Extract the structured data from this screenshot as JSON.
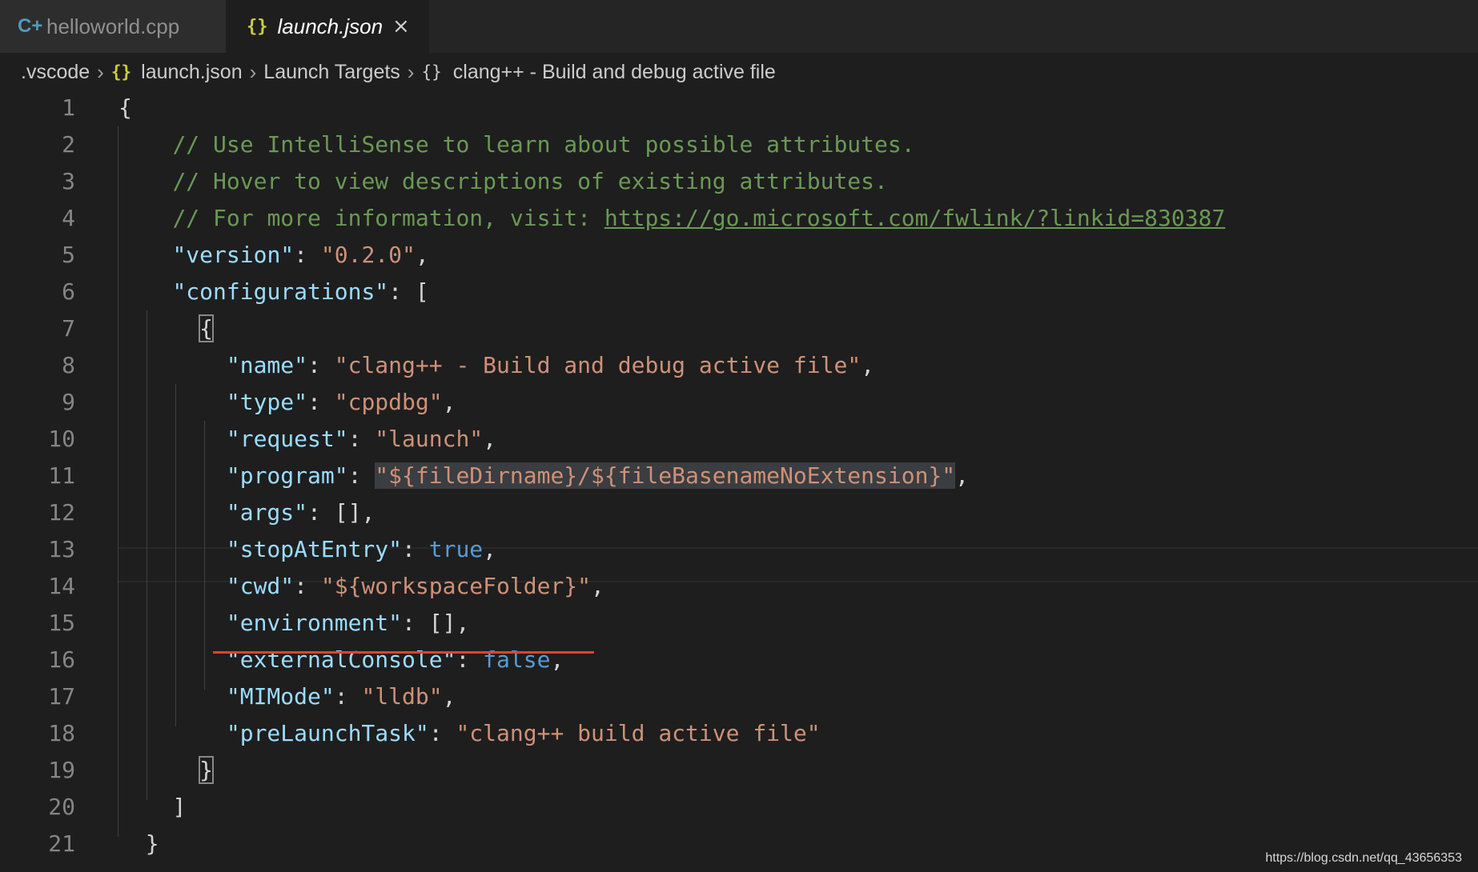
{
  "tabs": [
    {
      "label": "helloworld.cpp",
      "icon": "cpp-file-icon",
      "active": false
    },
    {
      "label": "launch.json",
      "icon": "json-file-icon",
      "active": true,
      "close_glyph": "×"
    }
  ],
  "breadcrumb": {
    "items": [
      ".vscode",
      "launch.json",
      "Launch Targets",
      "clang++ - Build and debug active file"
    ],
    "separator": "›",
    "json_icon": "{}",
    "object_icon": "{}"
  },
  "editor": {
    "line_numbers": [
      "1",
      "2",
      "3",
      "4",
      "5",
      "6",
      "7",
      "8",
      "9",
      "10",
      "11",
      "12",
      "13",
      "14",
      "15",
      "16",
      "17",
      "18",
      "19",
      "20",
      "21"
    ],
    "comments": {
      "line2": "// Use IntelliSense to learn about possible attributes.",
      "line3": "// Hover to view descriptions of existing attributes.",
      "line4_prefix": "// For more information, visit: ",
      "line4_link": "https://go.microsoft.com/fwlink/?linkid=830387"
    },
    "keys": {
      "version": "\"version\"",
      "configurations": "\"configurations\"",
      "name": "\"name\"",
      "type": "\"type\"",
      "request": "\"request\"",
      "program": "\"program\"",
      "args": "\"args\"",
      "stopAtEntry": "\"stopAtEntry\"",
      "cwd": "\"cwd\"",
      "environment": "\"environment\"",
      "externalConsole": "\"externalConsole\"",
      "MIMode": "\"MIMode\"",
      "preLaunchTask": "\"preLaunchTask\""
    },
    "values": {
      "version": "\"0.2.0\"",
      "name": "\"clang++ - Build and debug active file\"",
      "type": "\"cppdbg\"",
      "request": "\"launch\"",
      "program": "\"${fileDirname}/${fileBasenameNoExtension}\"",
      "args": "[]",
      "stopAtEntry": "true",
      "cwd": "\"${workspaceFolder}\"",
      "environment": "[]",
      "externalConsole": "false",
      "MIMode": "\"lldb\"",
      "preLaunchTask": "\"clang++ build active file\""
    },
    "punct": {
      "open_brace": "{",
      "close_brace": "}",
      "open_bracket": "[",
      "close_bracket": "]",
      "colon": ": ",
      "comma": ","
    }
  },
  "watermark": "https://blog.csdn.net/qq_43656353",
  "colors": {
    "background": "#1e1e1e",
    "comment": "#6a9955",
    "key": "#9cdcfe",
    "string": "#ce9178",
    "boolean": "#569cd6",
    "error_underline": "#e5412a"
  }
}
